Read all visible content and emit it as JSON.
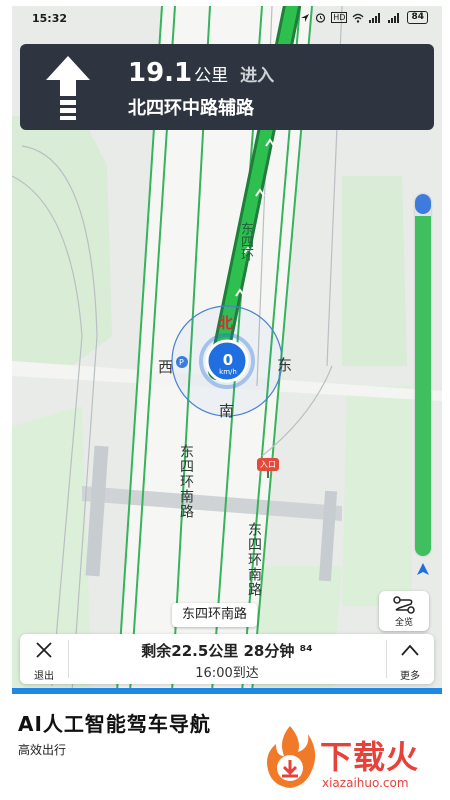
{
  "status_bar": {
    "time": "15:32",
    "indicators": "HD",
    "battery": "84"
  },
  "nav_banner": {
    "turn_icon": "straight-arrow-icon",
    "distance_value": "19.1",
    "distance_unit": "公里",
    "action": "进入",
    "road_name": "北四环中路辅路"
  },
  "compass": {
    "north": "北",
    "south": "南",
    "east": "东",
    "west": "西"
  },
  "speed": {
    "value": "0",
    "unit": "km/h"
  },
  "map_labels": {
    "route_road": "东四环",
    "left_road": "东四环南路",
    "right_road": "东四环南路",
    "bottom_chip": "东四环南路",
    "entry_marker": "入口"
  },
  "route_progress": {
    "fraction_remaining": 0.94
  },
  "overview_button": {
    "label": "全览"
  },
  "bottom_panel": {
    "exit_label": "退出",
    "remaining": "剩余22.5公里 28分钟 ⁸⁴",
    "arrival": "16:00到达",
    "more_label": "更多"
  },
  "promo": {
    "title": "AI人工智能驾车导航",
    "subtitle": "高效出行"
  },
  "watermark": {
    "brand": "下载火",
    "url": "xiazaihuo.com"
  },
  "colors": {
    "route_green": "#22b14c",
    "banner_bg": "#2f3540",
    "speed_blue": "#1f6fe0",
    "accent_blue": "#1e88e5",
    "logo_red": "#e8413a"
  }
}
